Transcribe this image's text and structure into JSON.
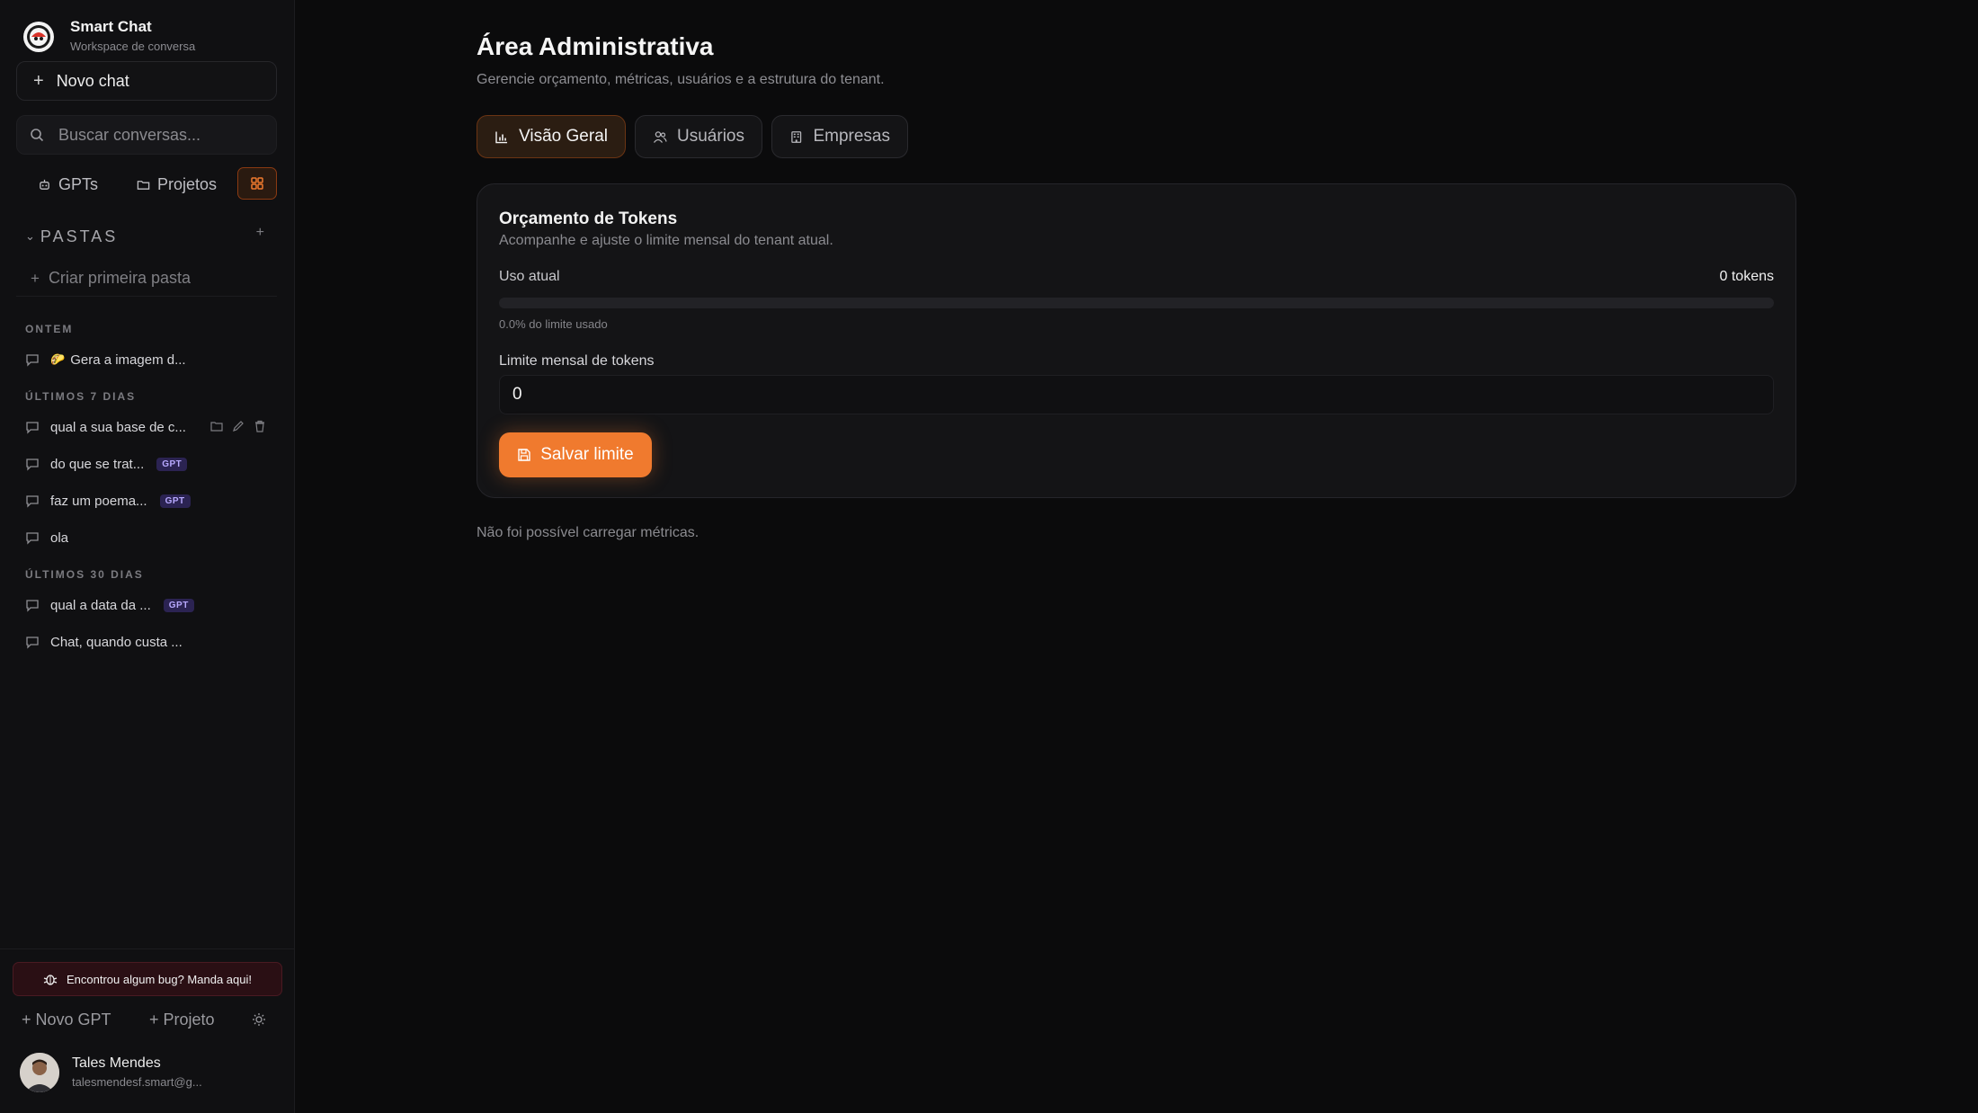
{
  "colors": {
    "accent": "#f07a2e",
    "badge_bg": "#2b2352",
    "badge_text": "#b8a9ff",
    "bug_bg": "#2a0f14"
  },
  "brand": {
    "name": "Smart Chat",
    "subtitle": "Workspace de conversa"
  },
  "sidebar": {
    "new_chat": "Novo chat",
    "search_placeholder": "Buscar conversas...",
    "gpts": "GPTs",
    "projects": "Projetos",
    "folders_label": "PASTAS",
    "create_folder": "Criar primeira pasta",
    "sections": [
      {
        "label": "ONTEM",
        "items": [
          {
            "title": "Gera a imagem d...",
            "emoji": "🌮",
            "badge": ""
          }
        ]
      },
      {
        "label": "ÚLTIMOS 7 DIAS",
        "items": [
          {
            "title": "qual a sua base de c...",
            "badge": ""
          },
          {
            "title": "do que se trat...",
            "badge": "GPT"
          },
          {
            "title": "faz um poema...",
            "badge": "GPT"
          },
          {
            "title": "ola",
            "badge": ""
          }
        ]
      },
      {
        "label": "ÚLTIMOS 30 DIAS",
        "items": [
          {
            "title": "qual a data da ...",
            "badge": "GPT"
          },
          {
            "title": "Chat, quando custa ...",
            "badge": ""
          }
        ]
      }
    ],
    "bug_report": "Encontrou algum bug? Manda aqui!",
    "new_gpt": "Novo GPT",
    "new_project": "Projeto",
    "user": {
      "name": "Tales Mendes",
      "email": "talesmendesf.smart@g..."
    }
  },
  "main": {
    "title": "Área Administrativa",
    "subtitle": "Gerencie orçamento, métricas, usuários e a estrutura do tenant.",
    "tabs": [
      {
        "label": "Visão Geral",
        "icon": "bar-chart-icon",
        "active": true
      },
      {
        "label": "Usuários",
        "icon": "users-icon",
        "active": false
      },
      {
        "label": "Empresas",
        "icon": "building-icon",
        "active": false
      }
    ],
    "budget": {
      "title": "Orçamento de Tokens",
      "subtitle": "Acompanhe e ajuste o limite mensal do tenant atual.",
      "usage_label": "Uso atual",
      "usage_value": "0 tokens",
      "usage_fraction": 0,
      "usage_percent_text": "0.0% do limite usado",
      "limit_label": "Limite mensal de tokens",
      "limit_value": "0",
      "save_label": "Salvar limite"
    },
    "metrics_error": "Não foi possível carregar métricas."
  }
}
